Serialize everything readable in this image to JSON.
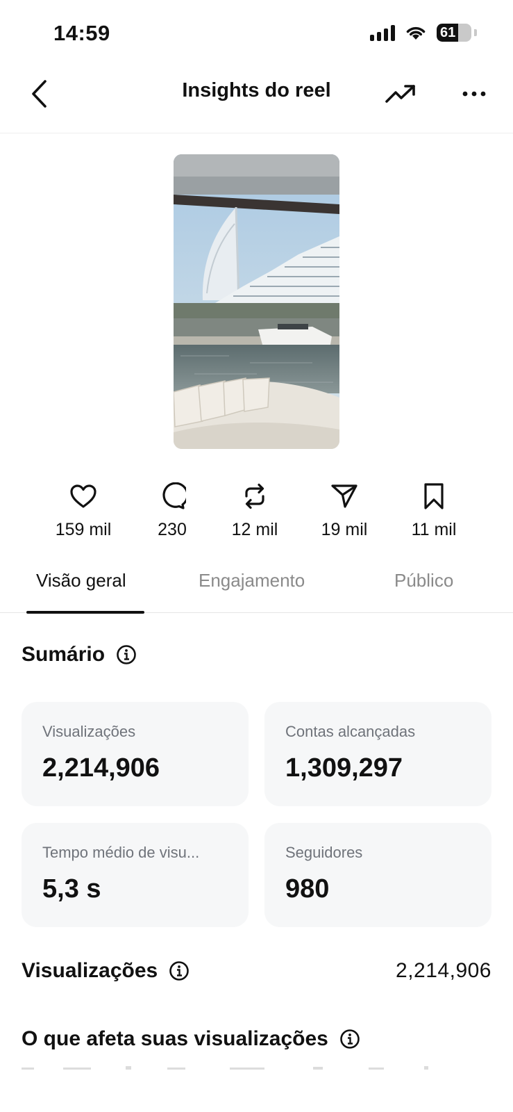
{
  "status_bar": {
    "time": "14:59",
    "battery": "61",
    "battery_level": 0.61,
    "icons": [
      "signal-icon",
      "wifi-icon",
      "battery-icon"
    ]
  },
  "header": {
    "title": "Insights do reel",
    "icons": [
      "back-chevron-icon",
      "trending-up-icon",
      "more-icon"
    ]
  },
  "stats": [
    {
      "icon": "heart-icon",
      "value": "159 mil"
    },
    {
      "icon": "comment-icon",
      "value": "230"
    },
    {
      "icon": "repost-icon",
      "value": "12 mil"
    },
    {
      "icon": "share-icon",
      "value": "19 mil"
    },
    {
      "icon": "bookmark-icon",
      "value": "11 mil"
    }
  ],
  "tabs": [
    {
      "label": "Visão geral",
      "active": true
    },
    {
      "label": "Engajamento",
      "active": false
    },
    {
      "label": "Público",
      "active": false
    }
  ],
  "summary": {
    "title": "Sumário",
    "cards": [
      {
        "label": "Visualizações",
        "value": "2,214,906"
      },
      {
        "label": "Contas alcançadas",
        "value": "1,309,297"
      },
      {
        "label": "Tempo médio de visu...",
        "value": "5,3 s"
      },
      {
        "label": "Seguidores",
        "value": "980"
      }
    ]
  },
  "views_row": {
    "label": "Visualizações",
    "value": "2,214,906"
  },
  "affects_section": {
    "title": "O que afeta suas visualizações"
  },
  "colors": {
    "text": "#111111",
    "muted": "#8a8a8a",
    "card_bg": "#f6f7f8",
    "card_label": "#6f737a"
  }
}
